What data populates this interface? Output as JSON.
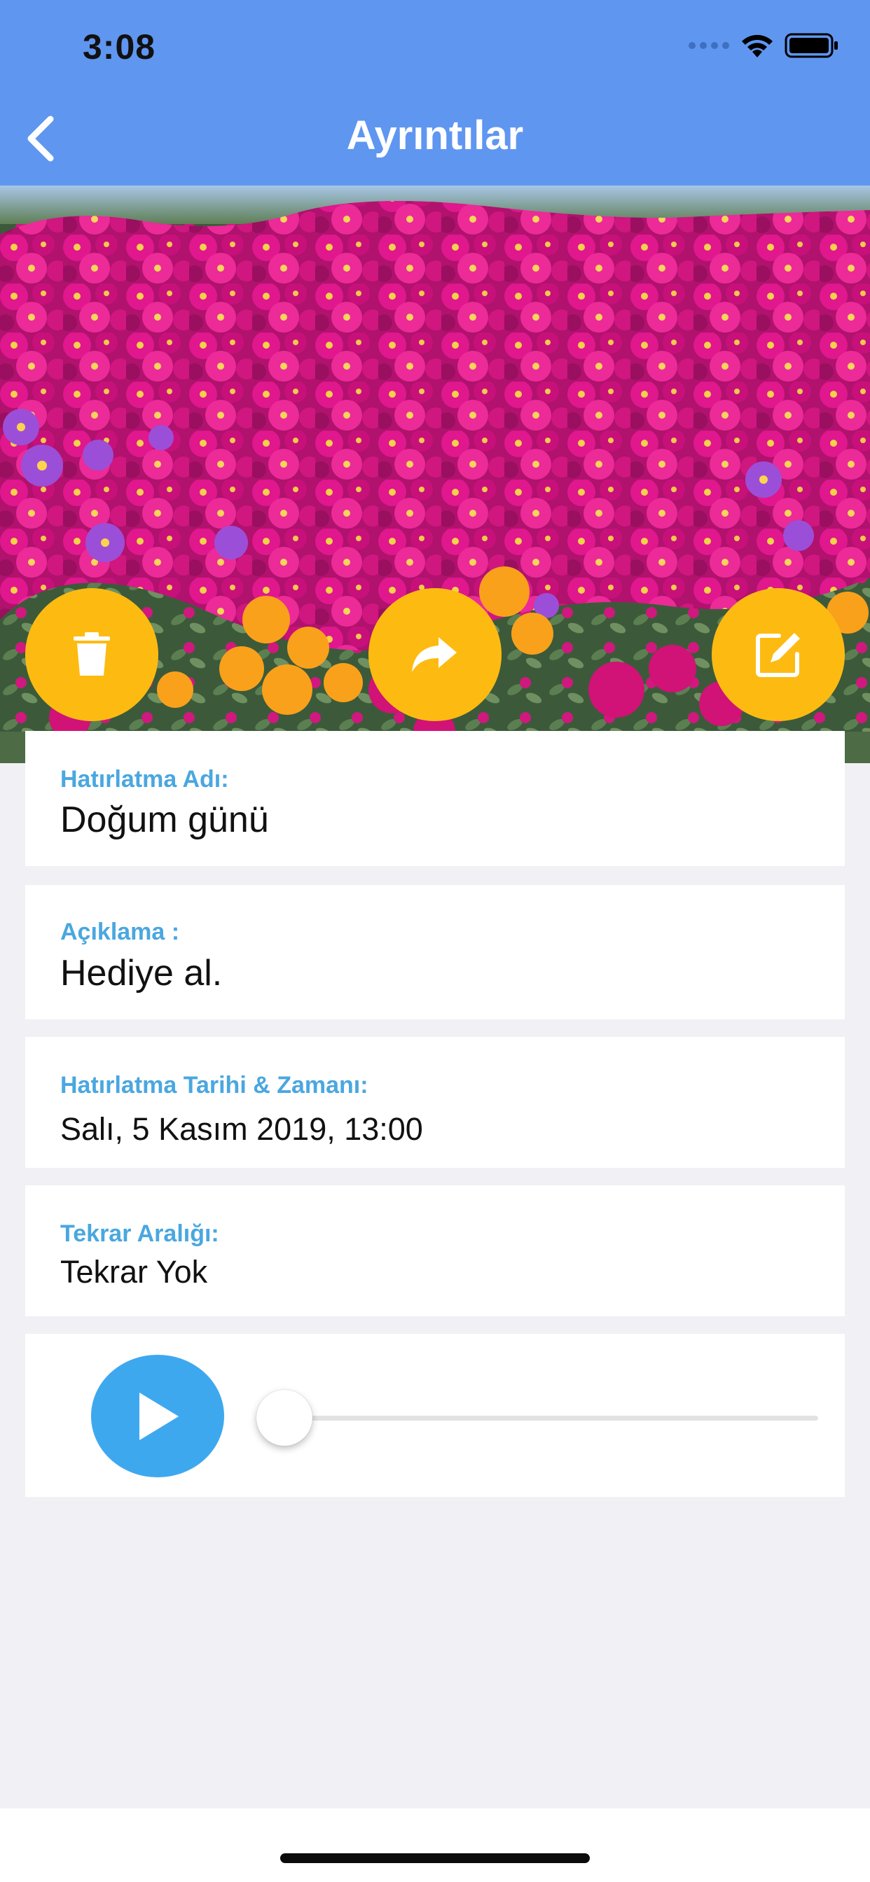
{
  "status_bar": {
    "time": "3:08",
    "signal_icon": "signal-dots-icon",
    "wifi_icon": "wifi-icon",
    "battery_icon": "battery-icon"
  },
  "nav": {
    "title": "Ayrıntılar",
    "back_icon": "chevron-left-icon"
  },
  "actions": {
    "delete_icon": "trash-icon",
    "share_icon": "share-arrow-icon",
    "edit_icon": "edit-icon"
  },
  "fields": [
    {
      "label": "Hatırlatma Adı:",
      "value": "Doğum günü"
    },
    {
      "label": "Açıklama :",
      "value": "Hediye al."
    },
    {
      "label": "Hatırlatma Tarihi & Zamanı:",
      "value": "Salı, 5 Kasım 2019, 13:00"
    },
    {
      "label": "Tekrar Aralığı:",
      "value": "Tekrar Yok"
    }
  ],
  "player": {
    "play_icon": "play-icon",
    "progress": 0
  },
  "colors": {
    "header": "#5f96f0",
    "accent_yellow": "#fdbb11",
    "label_blue": "#4aa7e0",
    "play_blue": "#3ea8ef",
    "background": "#f0f0f5"
  }
}
